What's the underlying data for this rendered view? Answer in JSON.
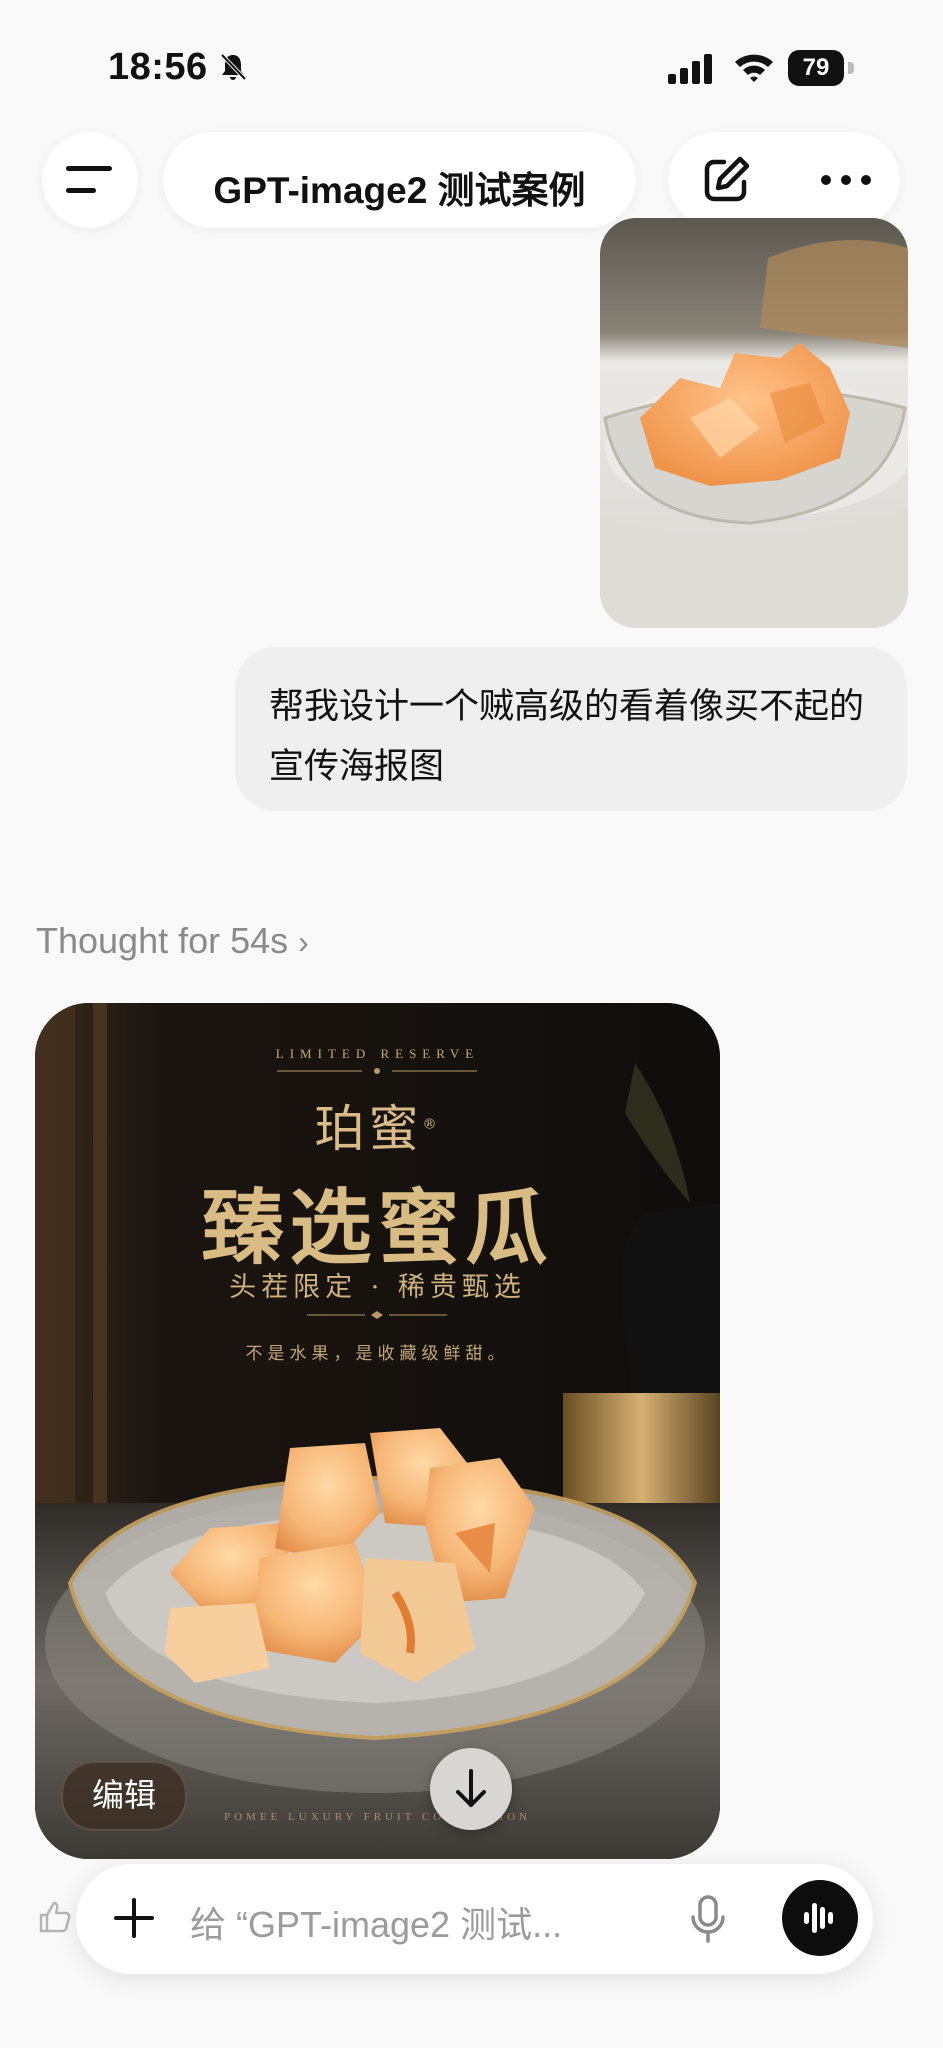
{
  "status": {
    "time": "18:56",
    "battery": "79"
  },
  "header": {
    "title": "GPT-image2 测试案例"
  },
  "conversation": {
    "user_message": "帮我设计一个贼高级的看着像买不起的宣传海报图",
    "thought_label": "Thought for 54s",
    "poster": {
      "limited": "LIMITED RESERVE",
      "brand": "珀蜜",
      "title": "臻选蜜瓜",
      "subtitle": "头茬限定 · 稀贵甄选",
      "slogan": "不是水果，是收藏级鲜甜。",
      "footer": "POMEE LUXURY FRUIT COLLECTION"
    },
    "edit_label": "编辑"
  },
  "composer": {
    "placeholder": "给 “GPT-image2 测试..."
  },
  "icons": [
    "menu-icon",
    "bell-off-icon",
    "signal-icon",
    "wifi-icon",
    "battery-icon",
    "edit-icon",
    "more-icon",
    "chevron-right-icon",
    "arrow-down-icon",
    "thumbs-up-icon",
    "plus-icon",
    "mic-icon",
    "voice-wave-icon"
  ],
  "colors": {
    "poster_gold": "#d9bc84",
    "poster_bg": "#151210",
    "voice_button": "#0d0d0d",
    "bubble": "#efefef"
  }
}
